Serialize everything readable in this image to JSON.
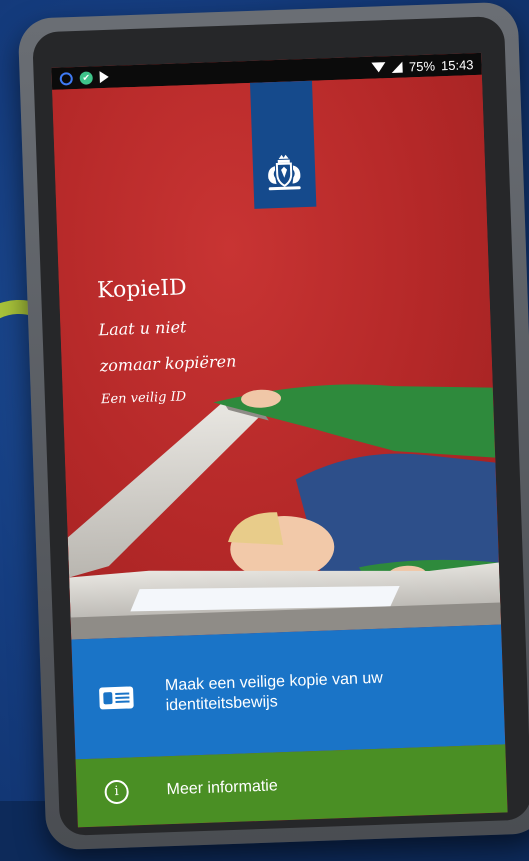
{
  "status_bar": {
    "battery": "75%",
    "time": "15:43",
    "icons": [
      "sync-icon",
      "checkmark-icon",
      "play-store-icon",
      "wifi-icon",
      "signal-icon"
    ]
  },
  "splash": {
    "app_title": "KopieID",
    "tagline_line1": "Laat u niet",
    "tagline_line2": "zomaar kopiëren",
    "subtagline": "Een veilig ID",
    "emblem": "coat-of-arms-icon"
  },
  "actions": {
    "primary_label": "Maak een veilige kopie van uw identiteitsbewijs",
    "primary_icon": "id-card-icon",
    "secondary_label": "Meer informatie",
    "secondary_icon": "info-icon"
  },
  "colors": {
    "hero_red": "#b52a2a",
    "ribbon_blue": "#154a8c",
    "primary_blue": "#1a74c7",
    "secondary_green": "#4a8f24",
    "background_blue": "#153d80"
  }
}
